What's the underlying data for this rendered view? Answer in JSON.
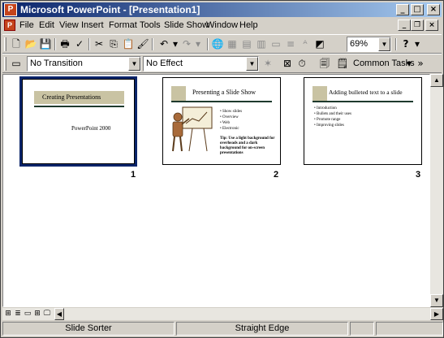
{
  "window": {
    "title": "Microsoft PowerPoint - [Presentation1]",
    "app_icon": "powerpoint-icon",
    "caption_buttons": [
      "_",
      "□",
      "×"
    ]
  },
  "menubar": {
    "items": [
      "File",
      "Edit",
      "View",
      "Insert",
      "Format",
      "Tools",
      "Slide Show",
      "Window",
      "Help"
    ],
    "doc_buttons": [
      "_",
      "❐",
      "×"
    ]
  },
  "toolbar_standard": {
    "zoom": "69%",
    "help_glyph": "?"
  },
  "toolbar_sorter": {
    "transition": "No Transition",
    "effect": "No Effect",
    "common_tasks": "Common Tasks"
  },
  "slides": [
    {
      "number": "1",
      "title": "Creating Presentations",
      "subtitle": "PowerPoint 2000",
      "selected": true
    },
    {
      "number": "2",
      "title": "Presenting a Slide Show",
      "bullets": [
        "Show slides",
        "Overview",
        "Web",
        "Electronic"
      ],
      "tip": "Tip: Use a light background for overheads and a dark background for on-screen presentations"
    },
    {
      "number": "3",
      "title": "Adding bulleted text to a slide",
      "bullets": [
        "Introduction",
        "Bullets and their uses",
        "Promote range",
        "Improving slides"
      ]
    }
  ],
  "statusbar": {
    "view": "Slide Sorter",
    "design": "Straight Edge"
  },
  "colors": {
    "title_bar_start": "#0a246a",
    "title_bar_end": "#a6caf0",
    "selection": "#0a246a",
    "slide_band": "#c9c3a3"
  }
}
